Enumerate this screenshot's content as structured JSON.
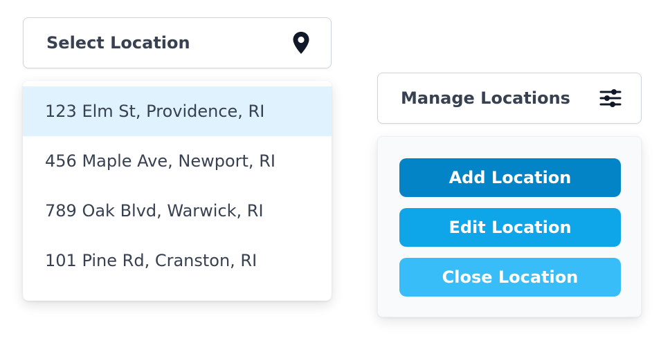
{
  "select_location": {
    "label": "Select Location",
    "icon": "map-pin-icon",
    "options": [
      {
        "label": "123 Elm St, Providence, RI",
        "selected": true
      },
      {
        "label": "456 Maple Ave, Newport, RI",
        "selected": false
      },
      {
        "label": "789 Oak Blvd, Warwick, RI",
        "selected": false
      },
      {
        "label": "101 Pine Rd, Cranston, RI",
        "selected": false
      }
    ]
  },
  "manage_locations": {
    "label": "Manage Locations",
    "icon": "sliders-icon",
    "actions": {
      "add": "Add Location",
      "edit": "Edit Location",
      "close": "Close Location"
    }
  },
  "colors": {
    "selected_bg": "#e0f2fe",
    "add_button": "#0284c7",
    "edit_button": "#0ea5e9",
    "close_button": "#38bdf8",
    "text": "#374151"
  }
}
